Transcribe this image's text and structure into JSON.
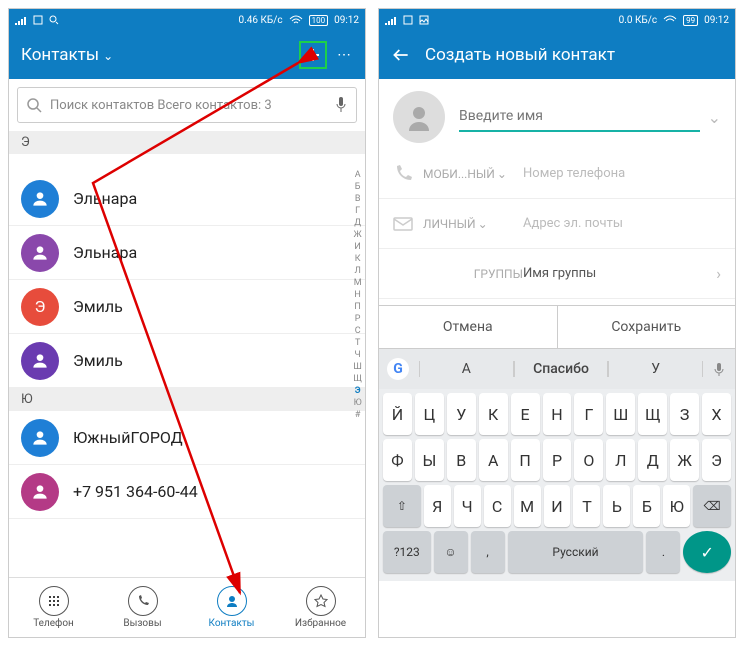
{
  "left": {
    "status": {
      "speed": "0.46 КБ/с",
      "batt": "100",
      "time": "09:12"
    },
    "title": "Контакты",
    "search": "Поиск контактов Всего контактов: 3",
    "sections": [
      "Э",
      "Ю"
    ],
    "contacts": [
      {
        "name": "Эльнара",
        "color": "#1f7fd6"
      },
      {
        "name": "Эльнара",
        "color": "#8a48ab"
      },
      {
        "name": "Эмиль",
        "color": "#e74c3c"
      },
      {
        "name": "Эмиль",
        "color": "#6a3bb0"
      },
      {
        "name": "ЮжныйГОРОД",
        "color": "#1f7fd6"
      },
      {
        "name": "+7 951 364-60-44",
        "color": "#b43a86"
      }
    ],
    "az": "А Б В Г Д Ж И К Л М Н П Р С Т Ч Ш Щ Э Ю #",
    "nav": [
      {
        "label": "Телефон"
      },
      {
        "label": "Вызовы"
      },
      {
        "label": "Контакты"
      },
      {
        "label": "Избранное"
      }
    ]
  },
  "right": {
    "status": {
      "speed": "0.0 КБ/с",
      "batt": "99",
      "time": "09:12"
    },
    "title": "Создать новый контакт",
    "fields": {
      "name": "Введите имя",
      "phoneLabel": "МОБИ...НЫЙ",
      "phone": "Номер телефона",
      "emailLabel": "ЛИЧНЫЙ",
      "email": "Адрес эл. почты",
      "groupLabel": "ГРУППЫ",
      "group": "Имя группы"
    },
    "btns": {
      "cancel": "Отмена",
      "save": "Сохранить"
    },
    "suggest": [
      "А",
      "Спасибо",
      "У"
    ],
    "kb": {
      "r1": [
        "Й",
        "Ц",
        "У",
        "К",
        "Е",
        "Н",
        "Г",
        "Ш",
        "Щ",
        "З",
        "Х"
      ],
      "r2": [
        "Ф",
        "Ы",
        "В",
        "А",
        "П",
        "Р",
        "О",
        "Л",
        "Д",
        "Ж",
        "Э"
      ],
      "r3": [
        "Я",
        "Ч",
        "С",
        "М",
        "И",
        "Т",
        "Ь",
        "Б",
        "Ю"
      ],
      "lang": "Русский",
      "sym": "?123"
    }
  }
}
